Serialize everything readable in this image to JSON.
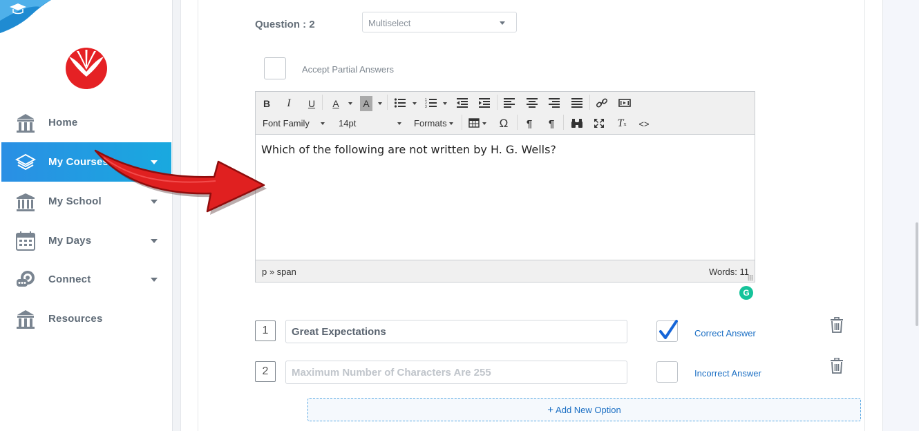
{
  "sidebar": {
    "items": [
      {
        "label": "Home",
        "icon": "building-icon",
        "has_caret": false,
        "active": false
      },
      {
        "label": "My Courses",
        "icon": "layers-icon",
        "has_caret": true,
        "active": true
      },
      {
        "label": "My School",
        "icon": "school-icon",
        "has_caret": true,
        "active": false
      },
      {
        "label": "My Days",
        "icon": "calendar-icon",
        "has_caret": true,
        "active": false
      },
      {
        "label": "Connect",
        "icon": "chat-icon",
        "has_caret": true,
        "active": false
      },
      {
        "label": "Resources",
        "icon": "building-icon",
        "has_caret": false,
        "active": false
      }
    ],
    "active_color": "#1ea3e0"
  },
  "question": {
    "label": "Question : 2",
    "type_value": "Multiselect",
    "partial_label": "Accept Partial Answers",
    "partial_checked": false
  },
  "editor": {
    "font_family_label": "Font Family",
    "font_size_label": "14pt",
    "formats_label": "Formats",
    "content": "Which of the following are not written by H. G. Wells?",
    "status_path": "p » span",
    "word_count": "Words: 11"
  },
  "options": [
    {
      "number": "1",
      "value": "Great Expectations",
      "placeholder": "Maximum Number of Characters Are 255",
      "checked": true,
      "status": "Correct Answer"
    },
    {
      "number": "2",
      "value": "",
      "placeholder": "Maximum Number of Characters Are 255",
      "checked": false,
      "status": "Incorrect Answer"
    }
  ],
  "add_option_label": "Add New Option",
  "colors": {
    "accent": "#1b6fc4",
    "check_blue": "#1565d8",
    "arrow_red": "#e02020"
  }
}
